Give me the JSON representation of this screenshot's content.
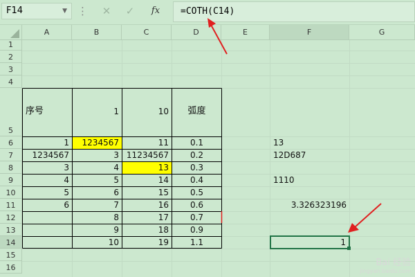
{
  "formula_bar": {
    "name_box": "F14",
    "separator": "⋮",
    "cancel_icon": "✕",
    "enter_icon": "✓",
    "fx_label": "fx",
    "formula": "=COTH(C14)"
  },
  "columns": [
    "A",
    "B",
    "C",
    "D",
    "E",
    "F",
    "G"
  ],
  "rows": [
    "1",
    "2",
    "3",
    "4",
    "5",
    "6",
    "7",
    "8",
    "9",
    "10",
    "11",
    "12",
    "13",
    "14",
    "15",
    "16"
  ],
  "table": {
    "header": {
      "a": "序号",
      "b": "1",
      "c": "10",
      "d": "弧度"
    },
    "body": [
      {
        "a": "1",
        "b": "1234567",
        "c": "11",
        "d": "0.1"
      },
      {
        "a": "1234567",
        "b": "3",
        "c": "11234567",
        "d": "0.2"
      },
      {
        "a": "3",
        "b": "4",
        "c": "13",
        "d": "0.3"
      },
      {
        "a": "4",
        "b": "5",
        "c": "14",
        "d": "0.4"
      },
      {
        "a": "5",
        "b": "6",
        "c": "15",
        "d": "0.5"
      },
      {
        "a": "6",
        "b": "7",
        "c": "16",
        "d": "0.6"
      },
      {
        "a": "",
        "b": "8",
        "c": "17",
        "d": "0.7"
      },
      {
        "a": "",
        "b": "9",
        "c": "18",
        "d": "0.9"
      },
      {
        "a": "",
        "b": "10",
        "c": "19",
        "d": "1.1"
      }
    ]
  },
  "col_f": {
    "f6": "13",
    "f7": "12D687",
    "f9": "1110",
    "f11": "3.326323196",
    "f14": "1"
  },
  "colors": {
    "grid_bg": "#cce8cf",
    "highlight": "#ffff00",
    "selection": "#217346",
    "arrow": "#e02020"
  },
  "watermark": {
    "brand": "Bai 经验",
    "url": "jingyan.baidu.com"
  }
}
